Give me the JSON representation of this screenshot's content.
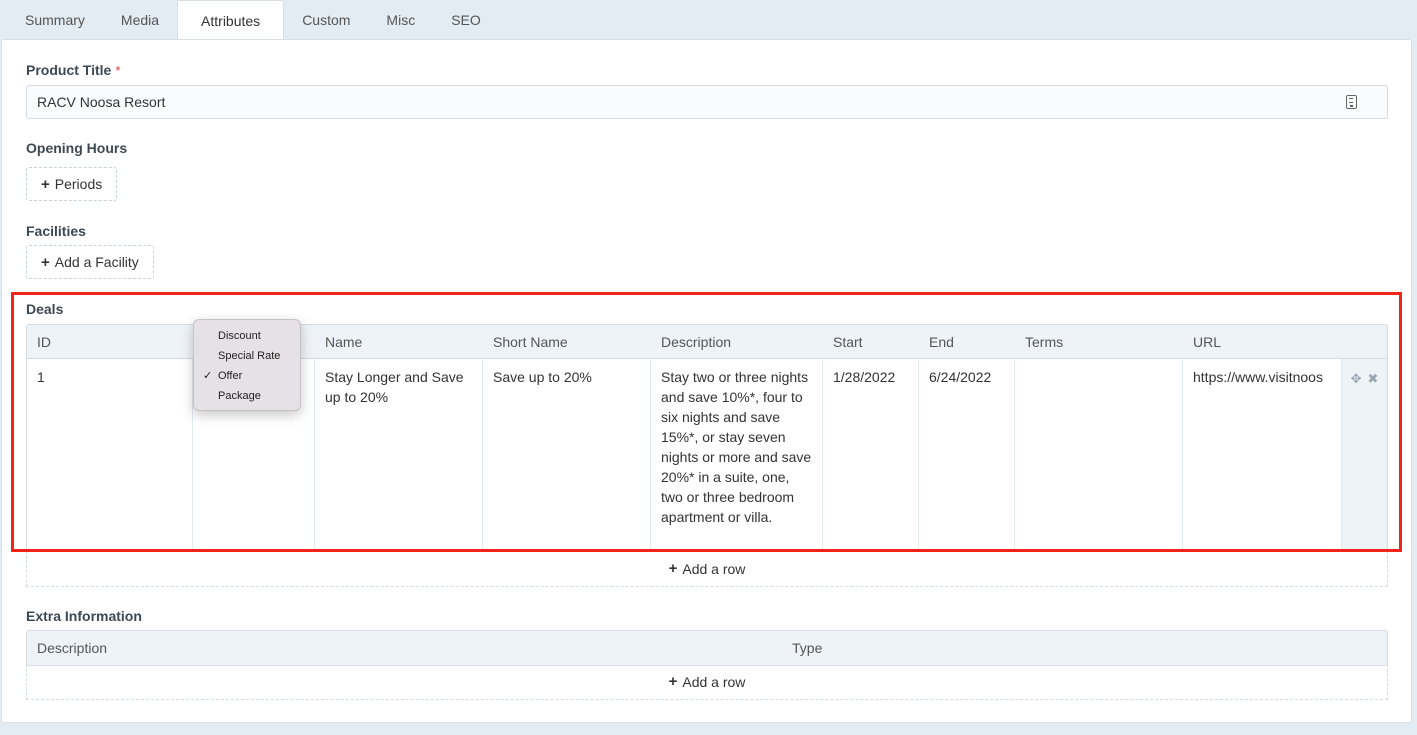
{
  "tabs": [
    "Summary",
    "Media",
    "Attributes",
    "Custom",
    "Misc",
    "SEO"
  ],
  "active_tab": "Attributes",
  "product_title": {
    "label": "Product Title",
    "required_mark": "*",
    "value": "RACV Noosa Resort"
  },
  "opening_hours": {
    "label": "Opening Hours",
    "button": "Periods"
  },
  "facilities": {
    "label": "Facilities",
    "button": "Add a Facility"
  },
  "deals": {
    "label": "Deals",
    "columns": [
      "ID",
      "",
      "Name",
      "Short Name",
      "Description",
      "Start",
      "End",
      "Terms",
      "URL"
    ],
    "rows": [
      {
        "id": "1",
        "type": "",
        "name": "Stay Longer and Save up to 20%",
        "short_name": "Save up to 20%",
        "description": "Stay two or three nights and save 10%*, four to six nights and save 15%*, or stay seven nights or more and save 20%* in a suite, one, two or three bedroom apartment or villa.",
        "start": "1/28/2022",
        "end": "6/24/2022",
        "terms": "",
        "url": "https://www.visitnoos"
      }
    ],
    "add_row": "Add a row",
    "type_dropdown": {
      "options": [
        "Discount",
        "Special Rate",
        "Offer",
        "Package"
      ],
      "selected": "Offer",
      "check_mark": "✓"
    }
  },
  "extra_information": {
    "label": "Extra Information",
    "columns": [
      "Description",
      "Type"
    ],
    "add_row": "Add a row"
  },
  "icons": {
    "plus": "+",
    "move": "✥",
    "close": "✖"
  },
  "colors": {
    "highlight": "#f2241a",
    "required": "#e53935",
    "header_bg": "#eef3f8",
    "page_bg": "#e3ebf3"
  }
}
